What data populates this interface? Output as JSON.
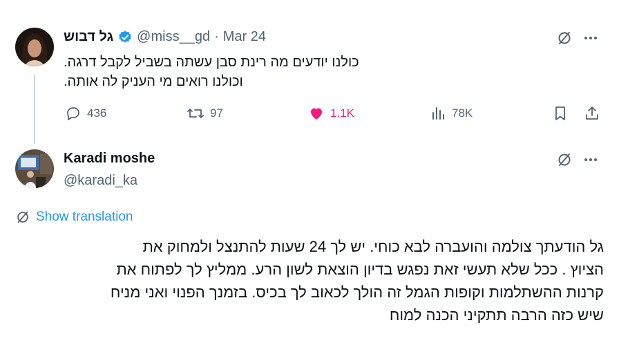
{
  "tweet": {
    "author_name": "גל דבוש",
    "handle": "@miss__gd",
    "separator": "·",
    "date": "Mar 24",
    "lines": [
      "כולנו יודעים מה רינת סבן עשתה בשביל לקבל דרגה.",
      "וכולנו רואים מי העניק לה אותה."
    ],
    "actions": {
      "replies": "436",
      "reposts": "97",
      "likes": "1.1K",
      "views": "78K"
    }
  },
  "reply": {
    "author_name": "Karadi moshe",
    "handle": "@karadi_ka",
    "show_translation": "Show translation",
    "lines": [
      "גל הודעתך צולמה והועברה לבא כוחי. יש לך 24 שעות להתנצל ולמחוק את",
      "הציוץ . ככל שלא תעשי זאת נפגש בדיון הוצאת לשון הרע. ממליץ לך לפתוח את",
      "קרנות ההשתלמות וקופות הגמל זה הולך לכאוב לך בכיס. בזמנך הפנוי ואני מניח",
      "שיש כזה הרבה תתקיני הכנה למוח"
    ]
  },
  "colors": {
    "verified": "#1d9bf0",
    "like": "#f91880",
    "muted": "#536471",
    "link": "#1d9bf0"
  }
}
